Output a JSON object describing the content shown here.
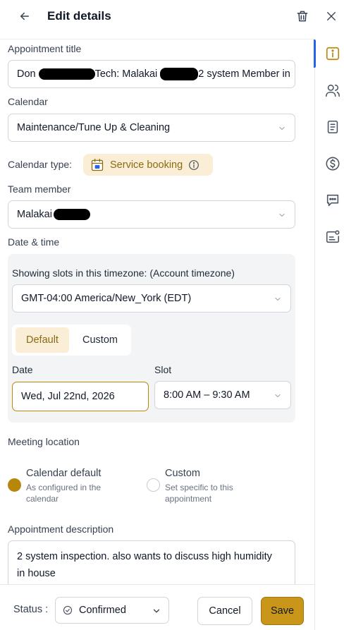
{
  "header": {
    "title": "Edit details"
  },
  "form": {
    "appointment_title": {
      "label": "Appointment title",
      "value_prefix": "Don",
      "value_mid": "Tech: Malakai",
      "value_suffix": "2 system Member in"
    },
    "calendar": {
      "label": "Calendar",
      "value": "Maintenance/Tune Up & Cleaning"
    },
    "calendar_type": {
      "label": "Calendar type:",
      "badge": "Service booking"
    },
    "team_member": {
      "label": "Team member",
      "value": "Malakai"
    },
    "date_time": {
      "label": "Date & time",
      "timezone_label": "Showing slots in this timezone: (Account timezone)",
      "timezone_value": "GMT-04:00 America/New_York (EDT)",
      "tab_default": "Default",
      "tab_custom": "Custom",
      "date_label": "Date",
      "date_value": "Wed, Jul 22nd, 2026",
      "slot_label": "Slot",
      "slot_value": "8:00 AM – 9:30 AM"
    },
    "meeting_location": {
      "label": "Meeting location",
      "option_default_title": "Calendar default",
      "option_default_desc_1": "As configured in the",
      "option_default_desc_2": "calendar",
      "option_custom_title": "Custom",
      "option_custom_desc_1": "Set specific to this",
      "option_custom_desc_2": "appointment",
      "selected": "Calendar default"
    },
    "description": {
      "label": "Appointment description",
      "line_1": "2 system inspection. also wants to discuss high humidity",
      "line_2": "in house"
    }
  },
  "footer": {
    "status_label": "Status :",
    "status_value": "Confirmed",
    "cancel_label": "Cancel",
    "save_label": "Save"
  },
  "rail": {
    "items": [
      "info-icon",
      "users-icon",
      "notes-icon",
      "dollar-icon",
      "chat-icon",
      "contact-card-icon"
    ],
    "active": "info-icon"
  },
  "colors": {
    "accent_gold": "#c9961a",
    "badge_bg": "#fbeed6",
    "badge_text": "#8a6a13",
    "rail_active": "#2563eb",
    "panel_bg": "#f3f4f6"
  }
}
